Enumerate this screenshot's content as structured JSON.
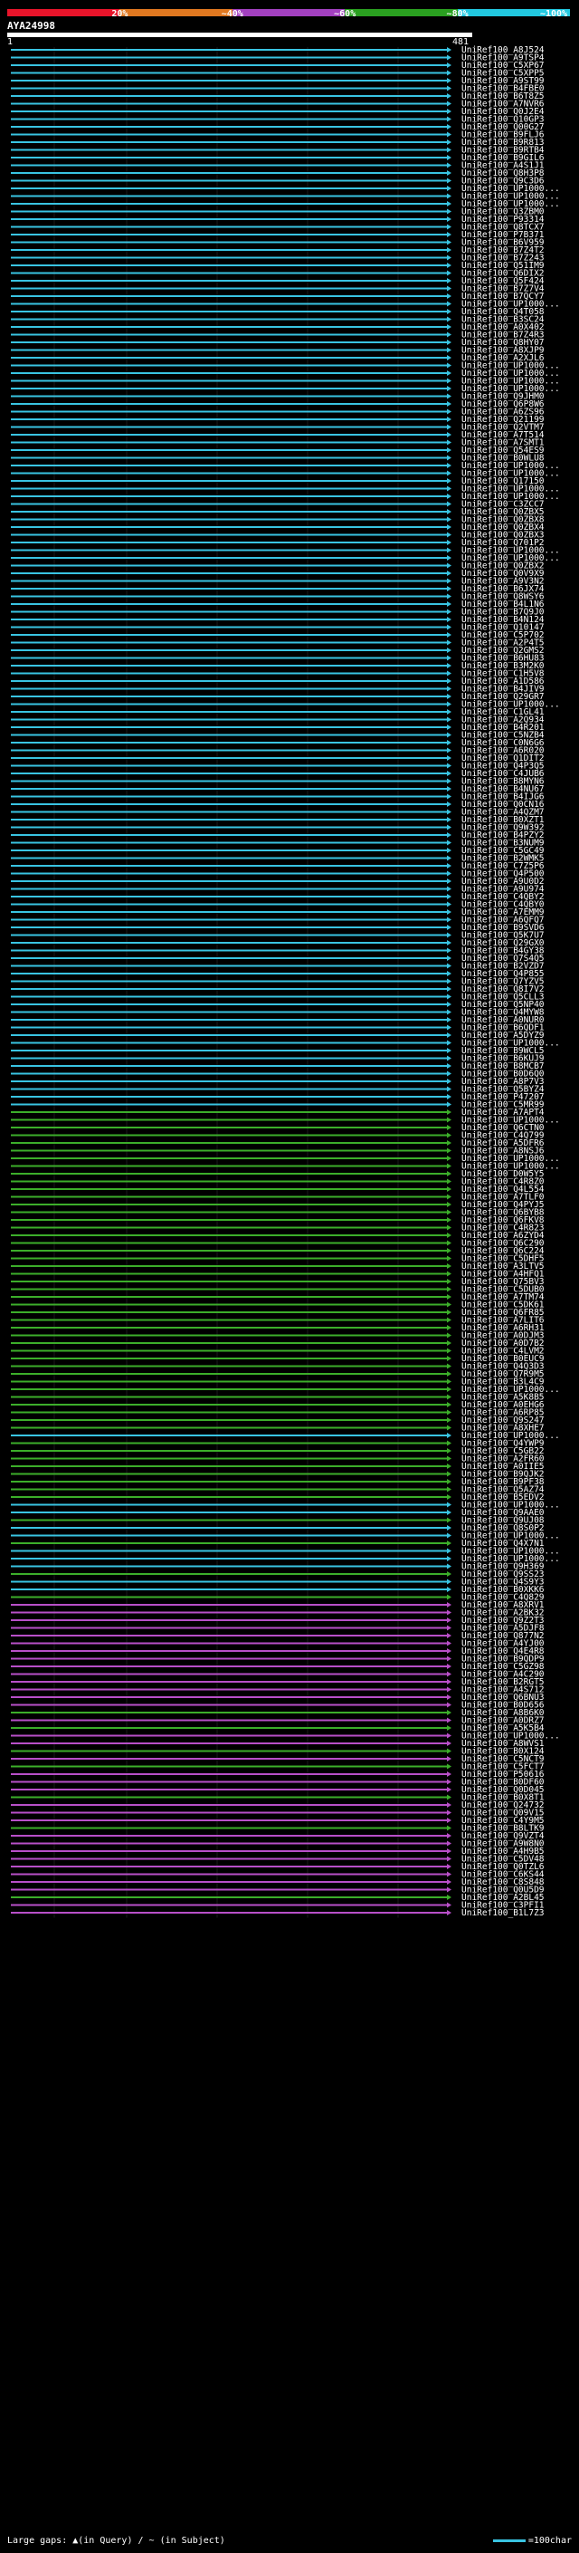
{
  "scale": {
    "labels": [
      "20%",
      "~40%",
      "~60%",
      "~80%",
      "~100%"
    ],
    "colors": [
      "#e8142a",
      "#e07820",
      "#a340c0",
      "#2aa020",
      "#22c8e0"
    ]
  },
  "query": {
    "id": "AYA24998",
    "start": "1",
    "end": "481"
  },
  "legend": {
    "gaps_text": "Large gaps: ▲(in Query) / ~ (in Subject)",
    "scale_text": "=100char"
  },
  "hits": [
    {
      "label": "UniRef100_A8J524",
      "pid": 100
    },
    {
      "label": "UniRef100_A9TSP4",
      "pid": 100
    },
    {
      "label": "UniRef100_C5XP67",
      "pid": 100
    },
    {
      "label": "UniRef100_C5XPP5",
      "pid": 100
    },
    {
      "label": "UniRef100_A9ST99",
      "pid": 100
    },
    {
      "label": "UniRef100_B4FBE0",
      "pid": 100
    },
    {
      "label": "UniRef100_B6T8Z5",
      "pid": 100
    },
    {
      "label": "UniRef100_A7NVR6",
      "pid": 100
    },
    {
      "label": "UniRef100_Q0J2E4",
      "pid": 100
    },
    {
      "label": "UniRef100_Q10GP3",
      "pid": 100
    },
    {
      "label": "UniRef100_Q00G27",
      "pid": 100
    },
    {
      "label": "UniRef100_B9FLJ6",
      "pid": 100
    },
    {
      "label": "UniRef100_B9R813",
      "pid": 100
    },
    {
      "label": "UniRef100_B9RTB4",
      "pid": 100
    },
    {
      "label": "UniRef100_B9GIL6",
      "pid": 100
    },
    {
      "label": "UniRef100_A4S1J1",
      "pid": 100
    },
    {
      "label": "UniRef100_Q8H3P8",
      "pid": 100
    },
    {
      "label": "UniRef100_Q9C3D6",
      "pid": 100
    },
    {
      "label": "UniRef100_UP1000...",
      "pid": 100
    },
    {
      "label": "UniRef100_UP1000...",
      "pid": 100
    },
    {
      "label": "UniRef100_UP1000...",
      "pid": 100
    },
    {
      "label": "UniRef100_Q3ZBM0",
      "pid": 100
    },
    {
      "label": "UniRef100_P93314",
      "pid": 100
    },
    {
      "label": "UniRef100_Q8TCX7",
      "pid": 100
    },
    {
      "label": "UniRef100_P7B371",
      "pid": 100
    },
    {
      "label": "UniRef100_B6V959",
      "pid": 100
    },
    {
      "label": "UniRef100_B7Z4T2",
      "pid": 100
    },
    {
      "label": "UniRef100_B7Z243",
      "pid": 100
    },
    {
      "label": "UniRef100_Q51IM9",
      "pid": 100
    },
    {
      "label": "UniRef100_Q6DIX2",
      "pid": 100
    },
    {
      "label": "UniRef100_Q5F424",
      "pid": 100
    },
    {
      "label": "UniRef100_B7Z7V4",
      "pid": 100
    },
    {
      "label": "UniRef100_B7QCY7",
      "pid": 100
    },
    {
      "label": "UniRef100_UP1000...",
      "pid": 100
    },
    {
      "label": "UniRef100_Q4T058",
      "pid": 100
    },
    {
      "label": "UniRef100_B3SC24",
      "pid": 100
    },
    {
      "label": "UniRef100_A0X402",
      "pid": 100
    },
    {
      "label": "UniRef100_B7Z4R3",
      "pid": 100
    },
    {
      "label": "UniRef100_Q8HY07",
      "pid": 100
    },
    {
      "label": "UniRef100_A8XJP9",
      "pid": 100
    },
    {
      "label": "UniRef100_A2XJL6",
      "pid": 100
    },
    {
      "label": "UniRef100_UP1000...",
      "pid": 100
    },
    {
      "label": "UniRef100_UP1000...",
      "pid": 100
    },
    {
      "label": "UniRef100_UP1000...",
      "pid": 100
    },
    {
      "label": "UniRef100_UP1000...",
      "pid": 100
    },
    {
      "label": "UniRef100_Q9JHM0",
      "pid": 100
    },
    {
      "label": "UniRef100_Q6P8W6",
      "pid": 100
    },
    {
      "label": "UniRef100_A6ZS96",
      "pid": 100
    },
    {
      "label": "UniRef100_Q21199",
      "pid": 100
    },
    {
      "label": "UniRef100_Q2VTM7",
      "pid": 100
    },
    {
      "label": "UniRef100_A7T514",
      "pid": 100
    },
    {
      "label": "UniRef100_A7SMT1",
      "pid": 100
    },
    {
      "label": "UniRef100_Q54ES9",
      "pid": 100
    },
    {
      "label": "UniRef100_B0WLU8",
      "pid": 100
    },
    {
      "label": "UniRef100_UP1000...",
      "pid": 100
    },
    {
      "label": "UniRef100_UP1000...",
      "pid": 100
    },
    {
      "label": "UniRef100_Q17150",
      "pid": 100
    },
    {
      "label": "UniRef100_UP1000...",
      "pid": 100
    },
    {
      "label": "UniRef100_UP1000...",
      "pid": 100
    },
    {
      "label": "UniRef100_C3ZCC7",
      "pid": 100
    },
    {
      "label": "UniRef100_Q0ZBX5",
      "pid": 100
    },
    {
      "label": "UniRef100_Q0ZBX8",
      "pid": 100
    },
    {
      "label": "UniRef100_Q0ZBX4",
      "pid": 100
    },
    {
      "label": "UniRef100_Q0ZBX3",
      "pid": 100
    },
    {
      "label": "UniRef100_Q701P2",
      "pid": 100
    },
    {
      "label": "UniRef100_UP1000...",
      "pid": 100
    },
    {
      "label": "UniRef100_UP1000...",
      "pid": 100
    },
    {
      "label": "UniRef100_Q0ZBX2",
      "pid": 100
    },
    {
      "label": "UniRef100_Q0V9X9",
      "pid": 100
    },
    {
      "label": "UniRef100_A9V3N2",
      "pid": 100
    },
    {
      "label": "UniRef100_B6JX74",
      "pid": 100
    },
    {
      "label": "UniRef100_Q8WSY6",
      "pid": 100
    },
    {
      "label": "UniRef100_B4L1N6",
      "pid": 100
    },
    {
      "label": "UniRef100_B7Q9J0",
      "pid": 100
    },
    {
      "label": "UniRef100_B4N124",
      "pid": 100
    },
    {
      "label": "UniRef100_Q10147",
      "pid": 100
    },
    {
      "label": "UniRef100_C5P702",
      "pid": 100
    },
    {
      "label": "UniRef100_A2P4T5",
      "pid": 100
    },
    {
      "label": "UniRef100_Q2GMS2",
      "pid": 100
    },
    {
      "label": "UniRef100_B6HU83",
      "pid": 100
    },
    {
      "label": "UniRef100_B3M2K0",
      "pid": 100
    },
    {
      "label": "UniRef100_C1H5V8",
      "pid": 100
    },
    {
      "label": "UniRef100_A1D586",
      "pid": 100
    },
    {
      "label": "UniRef100_B4JIV9",
      "pid": 100
    },
    {
      "label": "UniRef100_Q29GR7",
      "pid": 100
    },
    {
      "label": "UniRef100_UP1000...",
      "pid": 100
    },
    {
      "label": "UniRef100_C1GL41",
      "pid": 100
    },
    {
      "label": "UniRef100_A2Q934",
      "pid": 100
    },
    {
      "label": "UniRef100_B4R201",
      "pid": 100
    },
    {
      "label": "UniRef100_C5NZB4",
      "pid": 100
    },
    {
      "label": "UniRef100_C0N6G6",
      "pid": 100
    },
    {
      "label": "UniRef100_A6R020",
      "pid": 100
    },
    {
      "label": "UniRef100_Q1DIT2",
      "pid": 100
    },
    {
      "label": "UniRef100_Q4P3Q5",
      "pid": 100
    },
    {
      "label": "UniRef100_C4JUB6",
      "pid": 100
    },
    {
      "label": "UniRef100_B8MYN6",
      "pid": 100
    },
    {
      "label": "UniRef100_B4NU67",
      "pid": 100
    },
    {
      "label": "UniRef100_B4IJG6",
      "pid": 100
    },
    {
      "label": "UniRef100_Q0CN16",
      "pid": 100
    },
    {
      "label": "UniRef100_A4QZM7",
      "pid": 100
    },
    {
      "label": "UniRef100_B0XZT1",
      "pid": 100
    },
    {
      "label": "UniRef100_Q9W392",
      "pid": 100
    },
    {
      "label": "UniRef100_B4PZY2",
      "pid": 100
    },
    {
      "label": "UniRef100_B3NUM9",
      "pid": 100
    },
    {
      "label": "UniRef100_C5GC49",
      "pid": 100
    },
    {
      "label": "UniRef100_B2WMK5",
      "pid": 100
    },
    {
      "label": "UniRef100_C7Z5P6",
      "pid": 100
    },
    {
      "label": "UniRef100_Q4P500",
      "pid": 100
    },
    {
      "label": "UniRef100_A9U0D2",
      "pid": 100
    },
    {
      "label": "UniRef100_A9U974",
      "pid": 100
    },
    {
      "label": "UniRef100_C4QBY2",
      "pid": 100
    },
    {
      "label": "UniRef100_C4QBY0",
      "pid": 100
    },
    {
      "label": "UniRef100_A7EMM9",
      "pid": 100
    },
    {
      "label": "UniRef100_A6QFQ7",
      "pid": 100
    },
    {
      "label": "UniRef100_B9SVD6",
      "pid": 100
    },
    {
      "label": "UniRef100_Q5K7U7",
      "pid": 100
    },
    {
      "label": "UniRef100_Q29GX0",
      "pid": 100
    },
    {
      "label": "UniRef100_B4GY38",
      "pid": 100
    },
    {
      "label": "UniRef100_Q7S4Q5",
      "pid": 100
    },
    {
      "label": "UniRef100_B2VZD7",
      "pid": 100
    },
    {
      "label": "UniRef100_Q4P855",
      "pid": 100
    },
    {
      "label": "UniRef100_Q7YZV5",
      "pid": 100
    },
    {
      "label": "UniRef100_Q8I7V2",
      "pid": 100
    },
    {
      "label": "UniRef100_Q5CLL3",
      "pid": 100
    },
    {
      "label": "UniRef100_Q5NP40",
      "pid": 100
    },
    {
      "label": "UniRef100_Q4MYW8",
      "pid": 100
    },
    {
      "label": "UniRef100_A0NUR0",
      "pid": 100
    },
    {
      "label": "UniRef100_B6QDF1",
      "pid": 100
    },
    {
      "label": "UniRef100_A5DYZ9",
      "pid": 100
    },
    {
      "label": "UniRef100_UP1000...",
      "pid": 100
    },
    {
      "label": "UniRef100_B9WCL5",
      "pid": 100
    },
    {
      "label": "UniRef100_B6KUJ9",
      "pid": 100
    },
    {
      "label": "UniRef100_B8MCB7",
      "pid": 100
    },
    {
      "label": "UniRef100_B0D6Q0",
      "pid": 100
    },
    {
      "label": "UniRef100_A8P7V3",
      "pid": 100
    },
    {
      "label": "UniRef100_Q5BYZ4",
      "pid": 100
    },
    {
      "label": "UniRef100_P47207",
      "pid": 100
    },
    {
      "label": "UniRef100_C5MR99",
      "pid": 100
    },
    {
      "label": "UniRef100_A7APT4",
      "pid": 80
    },
    {
      "label": "UniRef100_UP1000...",
      "pid": 80
    },
    {
      "label": "UniRef100_Q6CTN0",
      "pid": 80
    },
    {
      "label": "UniRef100_C4Q799",
      "pid": 80
    },
    {
      "label": "UniRef100_A5DFR6",
      "pid": 80
    },
    {
      "label": "UniRef100_A8NSJ6",
      "pid": 80
    },
    {
      "label": "UniRef100_UP1000...",
      "pid": 80
    },
    {
      "label": "UniRef100_UP1000...",
      "pid": 80
    },
    {
      "label": "UniRef100_D0W5Y5",
      "pid": 80
    },
    {
      "label": "UniRef100_C4R8Z0",
      "pid": 80
    },
    {
      "label": "UniRef100_Q4L554",
      "pid": 80
    },
    {
      "label": "UniRef100_A7TLF0",
      "pid": 80
    },
    {
      "label": "UniRef100_Q4PYJ5",
      "pid": 80
    },
    {
      "label": "UniRef100_Q6BYB8",
      "pid": 80
    },
    {
      "label": "UniRef100_Q6FKV8",
      "pid": 80
    },
    {
      "label": "UniRef100_C4R823",
      "pid": 80
    },
    {
      "label": "UniRef100_A6ZYD4",
      "pid": 80
    },
    {
      "label": "UniRef100_Q6C290",
      "pid": 80
    },
    {
      "label": "UniRef100_Q6C224",
      "pid": 80
    },
    {
      "label": "UniRef100_C5DHF5",
      "pid": 80
    },
    {
      "label": "UniRef100_A3LTV5",
      "pid": 80
    },
    {
      "label": "UniRef100_A4HFQ1",
      "pid": 80
    },
    {
      "label": "UniRef100_Q75BV3",
      "pid": 80
    },
    {
      "label": "UniRef100_C5DUB0",
      "pid": 80
    },
    {
      "label": "UniRef100_A7TM74",
      "pid": 80
    },
    {
      "label": "UniRef100_C5DK61",
      "pid": 80
    },
    {
      "label": "UniRef100_Q6FR85",
      "pid": 80
    },
    {
      "label": "UniRef100_A7LIT6",
      "pid": 80
    },
    {
      "label": "UniRef100_A6RH31",
      "pid": 80
    },
    {
      "label": "UniRef100_A0DJM3",
      "pid": 80
    },
    {
      "label": "UniRef100_A0D7B2",
      "pid": 80
    },
    {
      "label": "UniRef100_C4LVM2",
      "pid": 80
    },
    {
      "label": "UniRef100_B0EUC9",
      "pid": 80
    },
    {
      "label": "UniRef100_Q4Q3D3",
      "pid": 80
    },
    {
      "label": "UniRef100_Q7R9M5",
      "pid": 80
    },
    {
      "label": "UniRef100_B3L4C9",
      "pid": 80
    },
    {
      "label": "UniRef100_UP1000...",
      "pid": 80
    },
    {
      "label": "UniRef100_A5K8B5",
      "pid": 80
    },
    {
      "label": "UniRef100_A0EHG6",
      "pid": 80
    },
    {
      "label": "UniRef100_A6RP85",
      "pid": 80
    },
    {
      "label": "UniRef100_Q9S247",
      "pid": 80
    },
    {
      "label": "UniRef100_A8XHE7",
      "pid": 80
    },
    {
      "label": "UniRef100_UP1000...",
      "pid": 100
    },
    {
      "label": "UniRef100_Q4YWP9",
      "pid": 80
    },
    {
      "label": "UniRef100_C5GB22",
      "pid": 80
    },
    {
      "label": "UniRef100_A2FR60",
      "pid": 80
    },
    {
      "label": "UniRef100_A0IIE5",
      "pid": 80
    },
    {
      "label": "UniRef100_B9QJK2",
      "pid": 80
    },
    {
      "label": "UniRef100_B9PF38",
      "pid": 80
    },
    {
      "label": "UniRef100_Q5AZ74",
      "pid": 80
    },
    {
      "label": "UniRef100_B5EDV2",
      "pid": 80
    },
    {
      "label": "UniRef100_UP1000...",
      "pid": 100
    },
    {
      "label": "UniRef100_Q9AAE0",
      "pid": 100
    },
    {
      "label": "UniRef100_Q9UJ08",
      "pid": 80
    },
    {
      "label": "UniRef100_Q8S0P2",
      "pid": 100
    },
    {
      "label": "UniRef100_UP1000...",
      "pid": 100
    },
    {
      "label": "UniRef100_Q4X7N1",
      "pid": 80
    },
    {
      "label": "UniRef100_UP1000...",
      "pid": 100
    },
    {
      "label": "UniRef100_UP1000...",
      "pid": 100
    },
    {
      "label": "UniRef100_Q9H369",
      "pid": 100
    },
    {
      "label": "UniRef100_Q9SS23",
      "pid": 80
    },
    {
      "label": "UniRef100_Q4S9Y3",
      "pid": 100
    },
    {
      "label": "UniRef100_B0XKK6",
      "pid": 100
    },
    {
      "label": "UniRef100_C4Q829",
      "pid": 80
    },
    {
      "label": "UniRef100_A8XRV1",
      "pid": 60
    },
    {
      "label": "UniRef100_A2BK32",
      "pid": 60
    },
    {
      "label": "UniRef100_Q9Z2T3",
      "pid": 60
    },
    {
      "label": "UniRef100_A5DJF8",
      "pid": 60
    },
    {
      "label": "UniRef100_Q877N2",
      "pid": 60
    },
    {
      "label": "UniRef100_A4YJ00",
      "pid": 60
    },
    {
      "label": "UniRef100_Q4E4R8",
      "pid": 60
    },
    {
      "label": "UniRef100_B9QDP9",
      "pid": 60
    },
    {
      "label": "UniRef100_C5GZ98",
      "pid": 60
    },
    {
      "label": "UniRef100_A4C290",
      "pid": 60
    },
    {
      "label": "UniRef100_B2RGT5",
      "pid": 60
    },
    {
      "label": "UniRef100_A4S712",
      "pid": 60
    },
    {
      "label": "UniRef100_Q6BNU3",
      "pid": 60
    },
    {
      "label": "UniRef100_B0D656",
      "pid": 60
    },
    {
      "label": "UniRef100_A8B6K0",
      "pid": 80
    },
    {
      "label": "UniRef100_A0DRZ7",
      "pid": 60
    },
    {
      "label": "UniRef100_A5K5B4",
      "pid": 80
    },
    {
      "label": "UniRef100_UP1000...",
      "pid": 60
    },
    {
      "label": "UniRef100_A8WVS1",
      "pid": 60
    },
    {
      "label": "UniRef100_B0X124",
      "pid": 80
    },
    {
      "label": "UniRef100_C5NCT9",
      "pid": 60
    },
    {
      "label": "UniRef100_C5FCT7",
      "pid": 80
    },
    {
      "label": "UniRef100_P50616",
      "pid": 60
    },
    {
      "label": "UniRef100_B0DF60",
      "pid": 60
    },
    {
      "label": "UniRef100_Q0D045",
      "pid": 60
    },
    {
      "label": "UniRef100_B0X8T1",
      "pid": 80
    },
    {
      "label": "UniRef100_Q24732",
      "pid": 60
    },
    {
      "label": "UniRef100_Q09V15",
      "pid": 60
    },
    {
      "label": "UniRef100_C4Y9M5",
      "pid": 60
    },
    {
      "label": "UniRef100_B8LTK9",
      "pid": 80
    },
    {
      "label": "UniRef100_Q9VZT4",
      "pid": 60
    },
    {
      "label": "UniRef100_A9W8N0",
      "pid": 60
    },
    {
      "label": "UniRef100_A4H9B5",
      "pid": 60
    },
    {
      "label": "UniRef100_C5DV48",
      "pid": 60
    },
    {
      "label": "UniRef100_Q0TZL6",
      "pid": 60
    },
    {
      "label": "UniRef100_C6KS44",
      "pid": 60
    },
    {
      "label": "UniRef100_C8S848",
      "pid": 60
    },
    {
      "label": "UniRef100_Q0U5D9",
      "pid": 60
    },
    {
      "label": "UniRef100_A2BL45",
      "pid": 80
    },
    {
      "label": "UniRef100_C3PFI1",
      "pid": 60
    },
    {
      "label": "UniRef100_B1L7Z3",
      "pid": 60
    }
  ]
}
